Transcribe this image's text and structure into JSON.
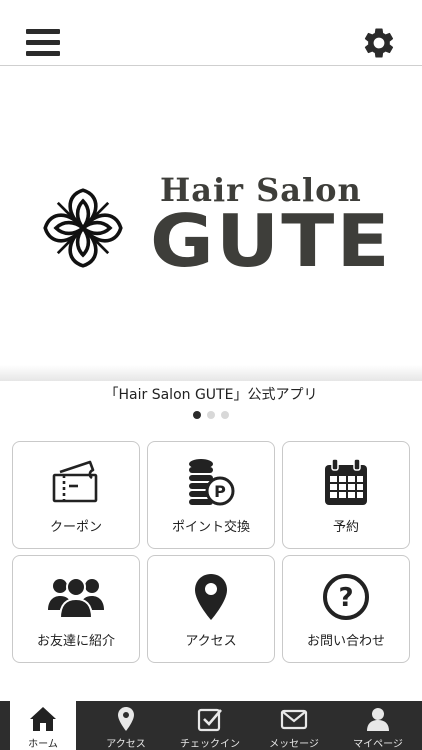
{
  "header": {
    "menu_icon": "hamburger-menu-icon",
    "settings_icon": "gear-icon"
  },
  "banner": {
    "logo_subtitle": "Hair Salon",
    "logo_title": "GUTE",
    "logo_mark": "flower-logo"
  },
  "caption": "「Hair Salon GUTE」公式アプリ",
  "carousel": {
    "count": 3,
    "active": 1
  },
  "menu": [
    {
      "label": "クーポン",
      "icon": "ticket-icon"
    },
    {
      "label": "ポイント交換",
      "icon": "coins-point-icon"
    },
    {
      "label": "予約",
      "icon": "calendar-icon"
    },
    {
      "label": "お友達に紹介",
      "icon": "group-users-icon"
    },
    {
      "label": "アクセス",
      "icon": "map-pin-icon"
    },
    {
      "label": "お問い合わせ",
      "icon": "question-circle-icon"
    }
  ],
  "tabs": [
    {
      "label": "ホーム",
      "icon": "home-icon",
      "active": true
    },
    {
      "label": "アクセス",
      "icon": "map-pin-icon",
      "active": false
    },
    {
      "label": "チェックイン",
      "icon": "checkin-icon",
      "active": false
    },
    {
      "label": "メッセージ",
      "icon": "envelope-icon",
      "active": false
    },
    {
      "label": "マイページ",
      "icon": "user-icon",
      "active": false
    }
  ],
  "colors": {
    "dark": "#2d2d2d",
    "logo": "#3e3e3a",
    "tile_border": "#c9c9c9",
    "dot_active": "#2b2b2b",
    "dot_inactive": "#d8d8d8"
  }
}
